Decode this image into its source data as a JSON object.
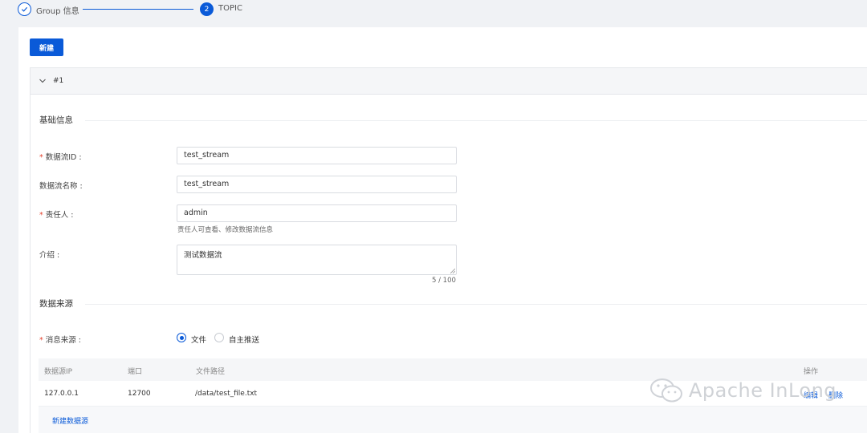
{
  "steps": [
    {
      "label": "Group 信息",
      "state": "done"
    },
    {
      "index": "2",
      "label": "TOPIC",
      "state": "active"
    }
  ],
  "toolbar": {
    "new_label": "新建"
  },
  "panel": {
    "title": "#1"
  },
  "basic": {
    "section_title": "基础信息",
    "stream_id": {
      "label": "数据流ID",
      "value": "test_stream",
      "required": true
    },
    "stream_name": {
      "label": "数据流名称",
      "value": "test_stream"
    },
    "owner": {
      "label": "责任人",
      "value": "admin",
      "hint": "责任人可查看、修改数据流信息",
      "required": true
    },
    "intro": {
      "label": "介绍",
      "value": "测试数据流",
      "counter": "5 / 100"
    }
  },
  "source": {
    "section_title": "数据来源",
    "message_source": {
      "label": "消息来源",
      "required": true,
      "options": [
        {
          "label": "文件",
          "checked": true
        },
        {
          "label": "自主推送",
          "checked": false
        }
      ]
    },
    "table": {
      "headers": [
        "数据源IP",
        "端口",
        "文件路径",
        "操作"
      ],
      "rows": [
        {
          "ip": "127.0.0.1",
          "port": "12700",
          "path": "/data/test_file.txt",
          "actions": [
            "编辑",
            "删除"
          ]
        }
      ],
      "add_label": "新建数据源"
    }
  },
  "watermark": {
    "text": "Apache InLong"
  },
  "colors": {
    "primary": "#0a5ad8",
    "required": "#e5432f",
    "background": "#f0f2f5"
  }
}
